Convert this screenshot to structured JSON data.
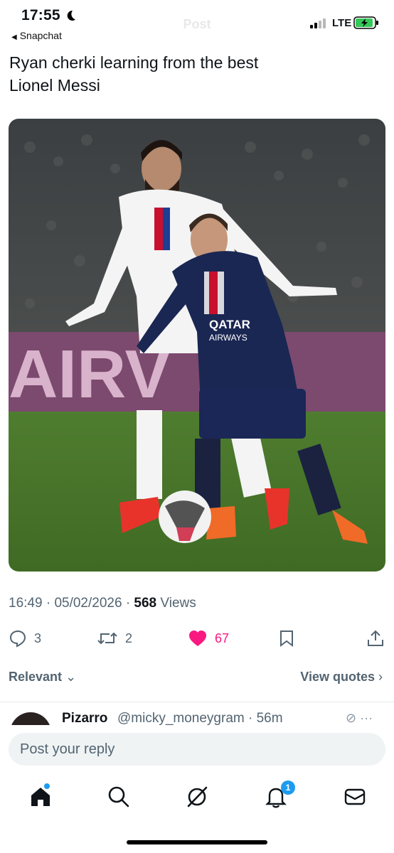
{
  "status_bar": {
    "time": "17:55",
    "back_app": "Snapchat",
    "network": "LTE",
    "ghost_title": "Post"
  },
  "post": {
    "text_line1": "Ryan cherki learning from the best",
    "text_line2": "Lionel Messi",
    "image_alt": "football-match-photo",
    "time": "16:49",
    "date": "05/02/2026",
    "views_count": "568",
    "views_label": "Views"
  },
  "actions": {
    "replies": "3",
    "reposts": "2",
    "likes": "67",
    "liked_color": "#f91880"
  },
  "sort": {
    "relevant_label": "Relevant",
    "view_quotes_label": "View quotes"
  },
  "reply_preview": {
    "name": "Pizarro",
    "handle": "@micky_moneygram · 56m"
  },
  "reply_input": {
    "placeholder": "Post your reply"
  },
  "nav": {
    "items": [
      "home-icon",
      "search-icon",
      "grok-icon",
      "bell-icon",
      "mail-icon"
    ],
    "notifications_badge": "1",
    "accent": "#1d9bf0"
  }
}
